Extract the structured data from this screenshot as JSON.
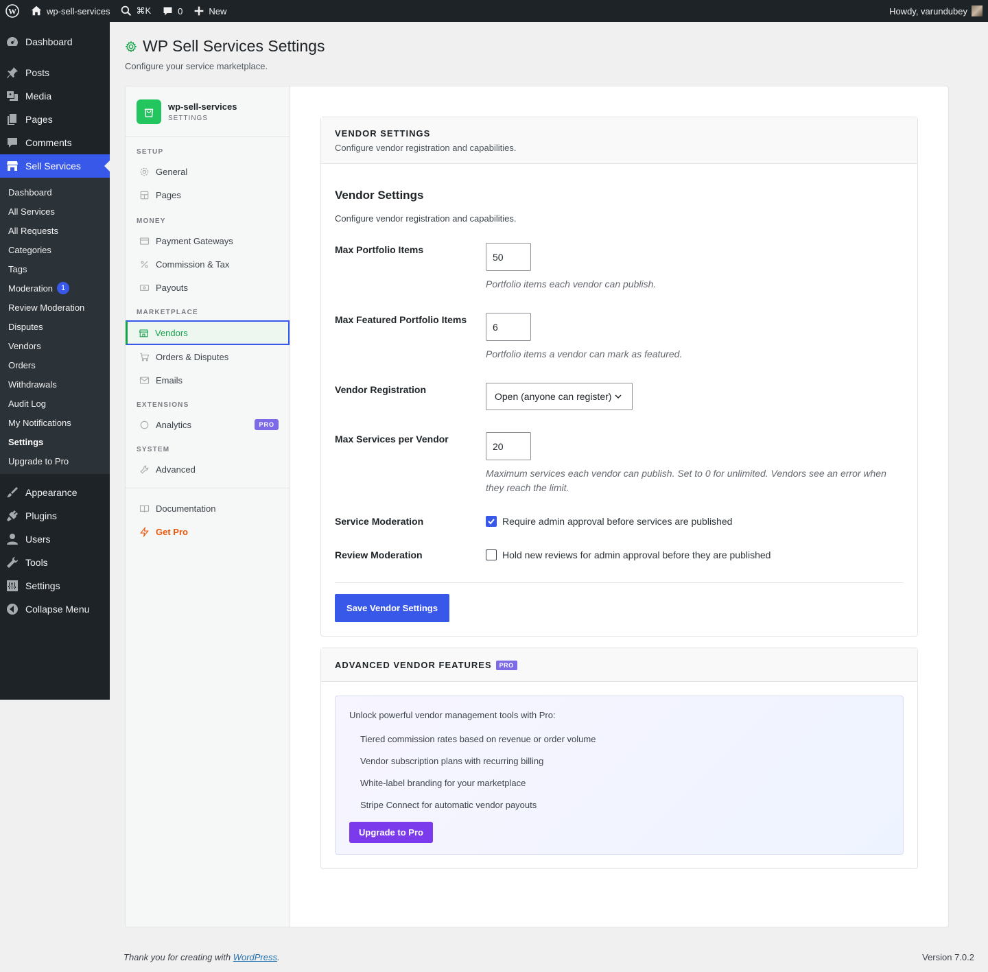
{
  "adminbar": {
    "site_name": "wp-sell-services",
    "shortcut": "⌘K",
    "comments_count": "0",
    "new_label": "New",
    "howdy": "Howdy, varundubey"
  },
  "menu": {
    "top_before": [
      {
        "label": "Dashboard",
        "icon": "dashboard-icon"
      },
      {
        "label": "Posts",
        "icon": "pin-icon"
      },
      {
        "label": "Media",
        "icon": "media-icon"
      },
      {
        "label": "Pages",
        "icon": "pages-icon"
      },
      {
        "label": "Comments",
        "icon": "comment-icon"
      }
    ],
    "current": {
      "label": "Sell Services",
      "icon": "store-icon"
    },
    "submenu": [
      {
        "label": "Dashboard"
      },
      {
        "label": "All Services"
      },
      {
        "label": "All Requests"
      },
      {
        "label": "Categories"
      },
      {
        "label": "Tags"
      },
      {
        "label": "Moderation",
        "badge": "1"
      },
      {
        "label": "Review Moderation"
      },
      {
        "label": "Disputes"
      },
      {
        "label": "Vendors"
      },
      {
        "label": "Orders"
      },
      {
        "label": "Withdrawals"
      },
      {
        "label": "Audit Log"
      },
      {
        "label": "My Notifications"
      },
      {
        "label": "Settings"
      },
      {
        "label": "Upgrade to Pro"
      }
    ],
    "top_after": [
      {
        "label": "Appearance",
        "icon": "brush-icon"
      },
      {
        "label": "Plugins",
        "icon": "plug-icon"
      },
      {
        "label": "Users",
        "icon": "user-icon"
      },
      {
        "label": "Tools",
        "icon": "wrench-icon"
      },
      {
        "label": "Settings",
        "icon": "sliders-icon"
      },
      {
        "label": "Collapse Menu",
        "icon": "collapse-icon"
      }
    ]
  },
  "page": {
    "title": "WP Sell Services Settings",
    "subtitle": "Configure your service marketplace."
  },
  "settings_nav": {
    "brand_name": "wp-sell-services",
    "brand_sub": "SETTINGS",
    "sections": {
      "setup": "SETUP",
      "money": "MONEY",
      "marketplace": "MARKETPLACE",
      "extensions": "EXTENSIONS",
      "system": "SYSTEM"
    },
    "items": {
      "general": "General",
      "pages": "Pages",
      "payment_gateways": "Payment Gateways",
      "commission_tax": "Commission & Tax",
      "payouts": "Payouts",
      "vendors": "Vendors",
      "orders_disputes": "Orders & Disputes",
      "emails": "Emails",
      "analytics": "Analytics",
      "analytics_badge": "PRO",
      "advanced": "Advanced",
      "documentation": "Documentation",
      "get_pro": "Get Pro"
    }
  },
  "vendor_card": {
    "header_title": "VENDOR SETTINGS",
    "header_desc": "Configure vendor registration and capabilities.",
    "section_title": "Vendor Settings",
    "section_desc": "Configure vendor registration and capabilities.",
    "max_portfolio": {
      "label": "Max Portfolio Items",
      "value": "50",
      "help": "Portfolio items each vendor can publish."
    },
    "max_featured": {
      "label": "Max Featured Portfolio Items",
      "value": "6",
      "help": "Portfolio items a vendor can mark as featured."
    },
    "registration": {
      "label": "Vendor Registration",
      "value": "Open (anyone can register)"
    },
    "max_services": {
      "label": "Max Services per Vendor",
      "value": "20",
      "help": "Maximum services each vendor can publish. Set to 0 for unlimited. Vendors see an error when they reach the limit."
    },
    "service_moderation": {
      "label": "Service Moderation",
      "text": "Require admin approval before services are published",
      "checked": true
    },
    "review_moderation": {
      "label": "Review Moderation",
      "text": "Hold new reviews for admin approval before they are published",
      "checked": false
    },
    "save_label": "Save Vendor Settings"
  },
  "advanced_card": {
    "header_title": "ADVANCED VENDOR FEATURES",
    "badge": "PRO",
    "intro": "Unlock powerful vendor management tools with Pro:",
    "features": [
      "Tiered commission rates based on revenue or order volume",
      "Vendor subscription plans with recurring billing",
      "White-label branding for your marketplace",
      "Stripe Connect for automatic vendor payouts"
    ],
    "upgrade_label": "Upgrade to Pro"
  },
  "footer": {
    "thanks_prefix": "Thank you for creating with ",
    "thanks_link": "WordPress",
    "thanks_suffix": ".",
    "version": "Version 7.0.2"
  },
  "colors": {
    "accent": "#3858e9",
    "green": "#16a34a",
    "pro_purple": "#7c3aed",
    "get_pro_orange": "#ea580c"
  }
}
